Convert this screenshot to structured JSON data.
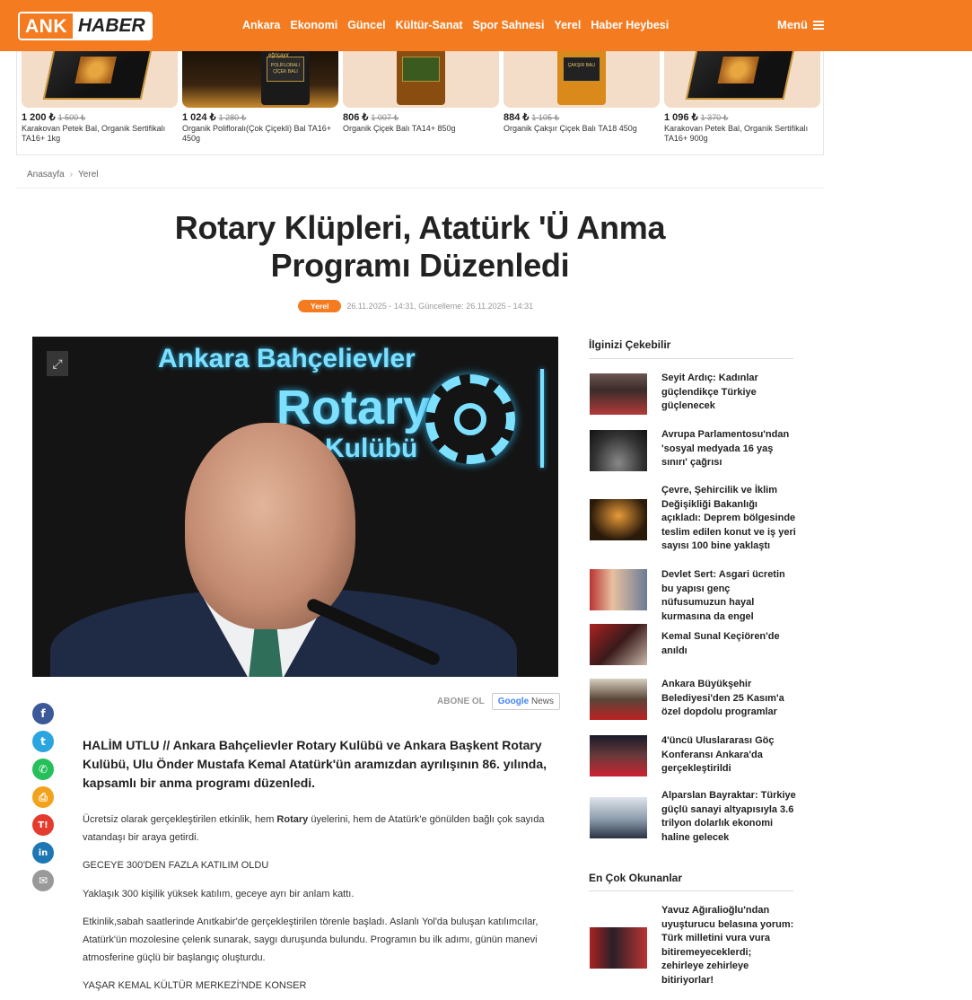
{
  "header": {
    "logo_part1": "ANK",
    "logo_part2": "HABER",
    "nav": [
      "Ankara",
      "Ekonomi",
      "Güncel",
      "Kültür-Sanat",
      "Spor Sahnesi",
      "Yerel",
      "Haber Heybesi"
    ],
    "menu_label": "Menü"
  },
  "products": [
    {
      "price": "1 200 ₺",
      "old_price": "1 500 ₺",
      "title": "Karakovan Petek Bal, Organik Sertifikalı TA16+ 1kg"
    },
    {
      "price": "1 024 ₺",
      "old_price": "1 280 ₺",
      "title": "Organik Polifloralı(Çok Çiçekli) Bal TA16+ 450g",
      "label": "POLİFLORALI ÇİÇEK BALI",
      "brand": "eğriçayır"
    },
    {
      "price": "806 ₺",
      "old_price": "1 007 ₺",
      "title": "Organik Çiçek Balı TA14+ 850g"
    },
    {
      "price": "884 ₺",
      "old_price": "1 105 ₺",
      "title": "Organik Çakşır Çiçek Balı TA18 450g",
      "label": "ÇAKŞIR BALI"
    },
    {
      "price": "1 096 ₺",
      "old_price": "1 370 ₺",
      "title": "Karakovan Petek Bal, Organik Sertifikalı TA16+ 900g"
    }
  ],
  "breadcrumb": {
    "home": "Anasayfa",
    "current": "Yerel"
  },
  "article": {
    "title": "Rotary Klüpleri, Atatürk 'Ü Anma Programı Düzenledi",
    "category": "Yerel",
    "date_meta": "26.11.2025 - 14:31, Güncelleme: 26.11.2025 - 14:31",
    "image_text": {
      "line1": "Ankara Bahçelievler",
      "line2": "Rotary",
      "line3": "Kulübü"
    },
    "subscribe_label": "ABONE OL",
    "gnews_brand": "Google",
    "gnews_word": "News",
    "lead": "HALİM UTLU // Ankara Bahçelievler Rotary Kulübü ve Ankara Başkent Rotary Kulübü, Ulu Önder Mustafa Kemal Atatürk'ün aramızdan ayrılışının 86. yılında, kapsamlı bir anma programı düzenledi.",
    "p1_a": "Ücretsiz olarak gerçekleştirilen etkinlik, hem ",
    "p1_b": "Rotary",
    "p1_c": " üyelerini, hem de Atatürk'e gönülden bağlı çok sayıda vatandaşı bir araya getirdi.",
    "p2": "GECEYE 300'DEN FAZLA KATILIM OLDU",
    "p3": "Yaklaşık 300 kişilik yüksek katılım, geceye ayrı bir anlam kattı.",
    "p4": "Etkinlik,sabah saatlerinde Anıtkabir'de gerçekleştirilen törenle başladı. Aslanlı Yol'da buluşan katılımcılar, Atatürk'ün mozolesine çelenk sunarak, saygı duruşunda bulundu. Programın bu ilk adımı, günün manevi atmosferine güçlü bir başlangıç oluşturdu.",
    "p5": "YAŞAR KEMAL KÜLTÜR MERKEZİ'NDE KONSER"
  },
  "sidebar": {
    "section1_title": "İlginizi Çekebilir",
    "items": [
      "Seyit Ardıç: Kadınlar güçlendikçe Türkiye güçlenecek",
      "Avrupa Parlamentosu'ndan 'sosyal medyada 16 yaş sınırı' çağrısı",
      "Çevre, Şehircilik ve İklim Değişikliği Bakanlığı açıkladı: Deprem bölgesinde teslim edilen konut ve iş yeri sayısı 100 bine yaklaştı",
      "Devlet Sert: Asgari ücretin bu yapısı genç nüfusumuzun hayal kurmasına da engel",
      "Kemal Sunal Keçiören'de anıldı",
      "Ankara Büyükşehir Belediyesi'den 25 Kasım'a özel dopdolu programlar",
      "4'üncü Uluslararası Göç Konferansı Ankara'da gerçekleştirildi",
      "Alparslan Bayraktar: Türkiye güçlü sanayi altyapısıyla 3.6 trilyon dolarlık ekonomi haline gelecek"
    ],
    "section2_title": "En Çok Okunanlar",
    "popular": [
      "Yavuz Ağıralioğlu'ndan uyuşturucu belasına yorum: Türk milletini vura vura bitiremeyecekler­di; zehirleye zehirleye bitiriyorlar!"
    ]
  },
  "colors": {
    "brand": "#f47b20"
  }
}
